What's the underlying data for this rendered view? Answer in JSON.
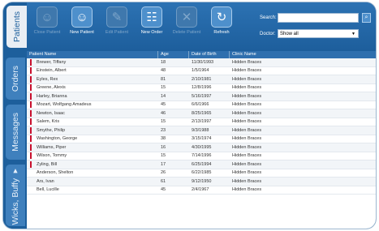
{
  "side_tabs": [
    "Patients",
    "Orders",
    "Messages",
    "Wicks, Buffy ▾"
  ],
  "toolbar": {
    "buttons": [
      {
        "label": "Close Patient",
        "icon": "close-patient-icon",
        "glyph": "☺",
        "enabled": false
      },
      {
        "label": "New Patient",
        "icon": "new-patient-icon",
        "glyph": "☺",
        "enabled": true
      },
      {
        "label": "Edit Patient",
        "icon": "edit-patient-icon",
        "glyph": "✎",
        "enabled": false
      },
      {
        "label": "New Order",
        "icon": "new-order-icon",
        "glyph": "☷",
        "enabled": true
      },
      {
        "label": "Delete Patient",
        "icon": "delete-patient-icon",
        "glyph": "✕",
        "enabled": false
      },
      {
        "label": "Refresh",
        "icon": "refresh-icon",
        "glyph": "↻",
        "enabled": true
      }
    ],
    "search_label": "Search:",
    "search_value": "",
    "doctor_label": "Doctor:",
    "doctor_value": "Show all"
  },
  "grid": {
    "columns": [
      "Patient Name",
      "Age",
      "Date of Birth",
      "Clinic Name"
    ],
    "rows": [
      {
        "flag": true,
        "name": "Brewer, Tiffany",
        "age": "18",
        "dob": "11/30/1993",
        "clinic": "Hidden Braces"
      },
      {
        "flag": true,
        "name": "Einstein, Albert",
        "age": "48",
        "dob": "1/5/1964",
        "clinic": "Hidden Braces"
      },
      {
        "flag": true,
        "name": "Eyles, Rex",
        "age": "81",
        "dob": "2/10/1981",
        "clinic": "Hidden Braces"
      },
      {
        "flag": true,
        "name": "Greene, Alexis",
        "age": "15",
        "dob": "12/8/1996",
        "clinic": "Hidden Braces"
      },
      {
        "flag": true,
        "name": "Harley, Brianna",
        "age": "14",
        "dob": "5/16/1997",
        "clinic": "Hidden Braces"
      },
      {
        "flag": true,
        "name": "Mozart, Wolfgang Amadeus",
        "age": "45",
        "dob": "6/6/1966",
        "clinic": "Hidden Braces"
      },
      {
        "flag": true,
        "name": "Newton, Isaac",
        "age": "46",
        "dob": "8/25/1965",
        "clinic": "Hidden Braces"
      },
      {
        "flag": true,
        "name": "Salem, Kris",
        "age": "15",
        "dob": "2/13/1997",
        "clinic": "Hidden Braces"
      },
      {
        "flag": true,
        "name": "Smythe, Philip",
        "age": "23",
        "dob": "9/3/1988",
        "clinic": "Hidden Braces"
      },
      {
        "flag": true,
        "name": "Washington, George",
        "age": "38",
        "dob": "3/15/1974",
        "clinic": "Hidden Braces"
      },
      {
        "flag": true,
        "name": "Williams, Piper",
        "age": "16",
        "dob": "4/30/1995",
        "clinic": "Hidden Braces"
      },
      {
        "flag": true,
        "name": "Wilson, Tommy",
        "age": "15",
        "dob": "7/14/1996",
        "clinic": "Hidden Braces"
      },
      {
        "flag": true,
        "name": "Zyling, Bill",
        "age": "17",
        "dob": "6/25/1994",
        "clinic": "Hidden Braces"
      },
      {
        "flag": false,
        "name": "Anderson, Shelton",
        "age": "26",
        "dob": "6/22/1985",
        "clinic": "Hidden Braces"
      },
      {
        "flag": false,
        "name": "Ars, Ivan",
        "age": "61",
        "dob": "9/12/1950",
        "clinic": "Hidden Braces"
      },
      {
        "flag": false,
        "name": "Bell, Lucille",
        "age": "45",
        "dob": "2/4/1967",
        "clinic": "Hidden Braces"
      }
    ]
  }
}
